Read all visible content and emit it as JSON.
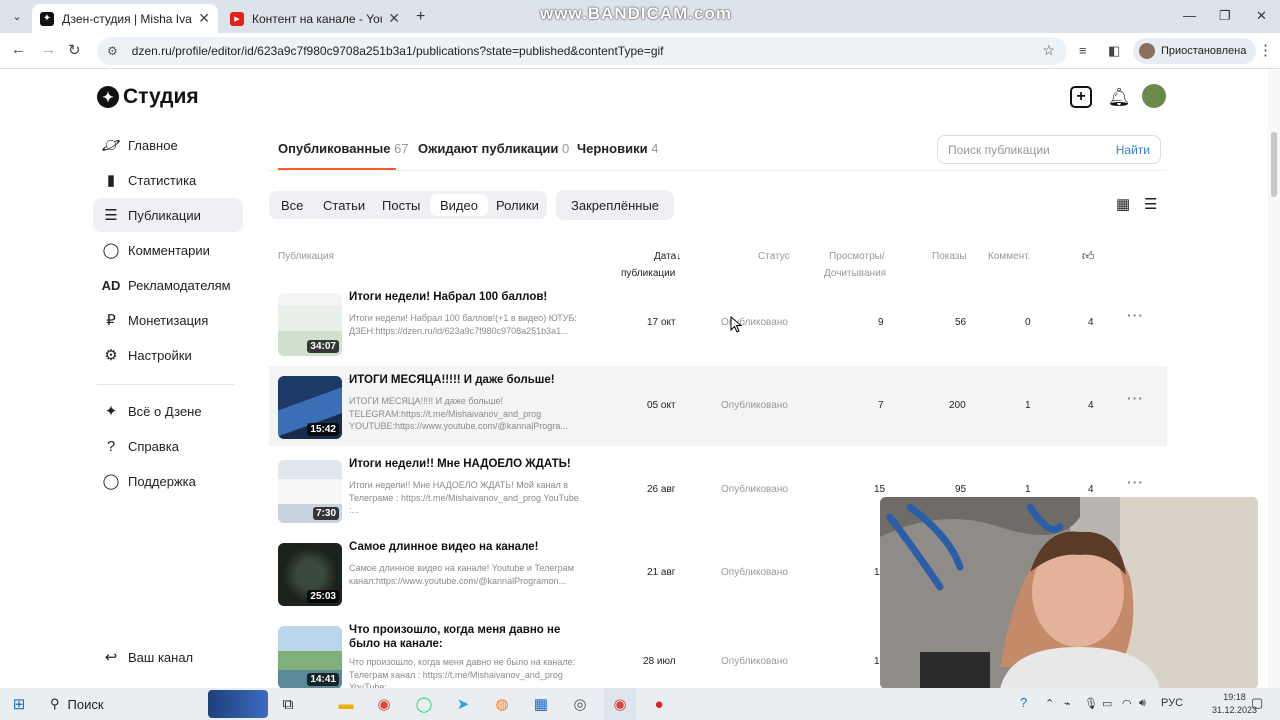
{
  "browser": {
    "tabs": [
      {
        "title": "Дзен-студия | Misha Ivanov | Д",
        "active": true
      },
      {
        "title": "Контент на канале - YouTube S",
        "active": false
      }
    ],
    "watermark": "www.BANDICAM.com",
    "url": "dzen.ru/profile/editor/id/623a9c7f980c9708a251b3a1/publications?state=published&contentType=gif",
    "profile_label": "Приостановлена"
  },
  "header": {
    "logo_text": "Студия"
  },
  "sidebar": {
    "items": [
      {
        "label": "Главное"
      },
      {
        "label": "Статистика"
      },
      {
        "label": "Публикации"
      },
      {
        "label": "Комментарии"
      },
      {
        "label": "Рекламодателям"
      },
      {
        "label": "Монетизация"
      },
      {
        "label": "Настройки"
      },
      {
        "label": "Всё о Дзене"
      },
      {
        "label": "Справка"
      },
      {
        "label": "Поддержка"
      }
    ],
    "channel_label": "Ваш канал"
  },
  "tabs": [
    {
      "label": "Опубликованные",
      "count": "67"
    },
    {
      "label": "Ожидают публикации",
      "count": "0"
    },
    {
      "label": "Черновики",
      "count": "4"
    }
  ],
  "search": {
    "placeholder": "Поиск публикации",
    "button": "Найти"
  },
  "filters": [
    "Все",
    "Статьи",
    "Посты",
    "Видео",
    "Ролики"
  ],
  "pinned_label": "Закреплённые",
  "table": {
    "headers": {
      "publication": "Публикация",
      "date1": "Дата",
      "date2": "публикации",
      "status": "Статус",
      "views1": "Просмотры/",
      "views2": "Дочитывания",
      "impressions": "Показы",
      "comments": "Коммент."
    },
    "rows": [
      {
        "title": "Итоги недели! Набрал 100 баллов!",
        "desc": "Итоги недели! Набрал 100 баллов!(+1 в видео) ЮТУБ: ДЗЕН:https://dzen.ru/id/623a9c7f980c9708a251b3a1...",
        "duration": "34:07",
        "date": "17 окт",
        "status": "Опубликовано",
        "views": "9",
        "impressions": "56",
        "comments": "0",
        "likes": "4"
      },
      {
        "title": "ИТОГИ МЕСЯЦА!!!!! И даже больше!",
        "desc": "ИТОГИ МЕСЯЦА!!!!! И даже больше! TELEGRAM:https://t.me/Mishaivanov_and_prog YOUTUBE:https://www.youtube.com/@kannalProgra...",
        "duration": "15:42",
        "date": "05 окт",
        "status": "Опубликовано",
        "views": "7",
        "impressions": "200",
        "comments": "1",
        "likes": "4"
      },
      {
        "title": "Итоги недели!! Мне НАДОЕЛО ЖДАТЬ!",
        "desc": "Итоги недели!! Мне НАДОЕЛО ЖДАТЬ! Мой канал в Телеграме : https://t.me/Mishaivanov_and_prog YouTube :...",
        "duration": "7:30",
        "date": "26 авг",
        "status": "Опубликовано",
        "views": "15",
        "impressions": "95",
        "comments": "1",
        "likes": "4"
      },
      {
        "title": "Самое длинное видео на канале!",
        "desc": "Самое длинное видео на канале! Youtube и Телеграм канал:https://www.youtube.com/@kannalProgramon...",
        "duration": "25:03",
        "date": "21 авг",
        "status": "Опубликовано",
        "views": "11",
        "impressions": "",
        "comments": "",
        "likes": ""
      },
      {
        "title": "Что произошло, когда меня давно не было на канале:",
        "desc": "Что произошло, когда меня давно не было на канале: Телеграм канал : https://t.me/Mishaivanov_and_prog YouTube:...",
        "duration": "14:41",
        "date": "28 июл",
        "status": "Опубликовано",
        "views": "19",
        "impressions": "",
        "comments": "",
        "likes": ""
      }
    ]
  },
  "taskbar": {
    "search_label": "Поиск",
    "lang": "РУС",
    "time": "19:18",
    "date": "31.12.2023"
  }
}
